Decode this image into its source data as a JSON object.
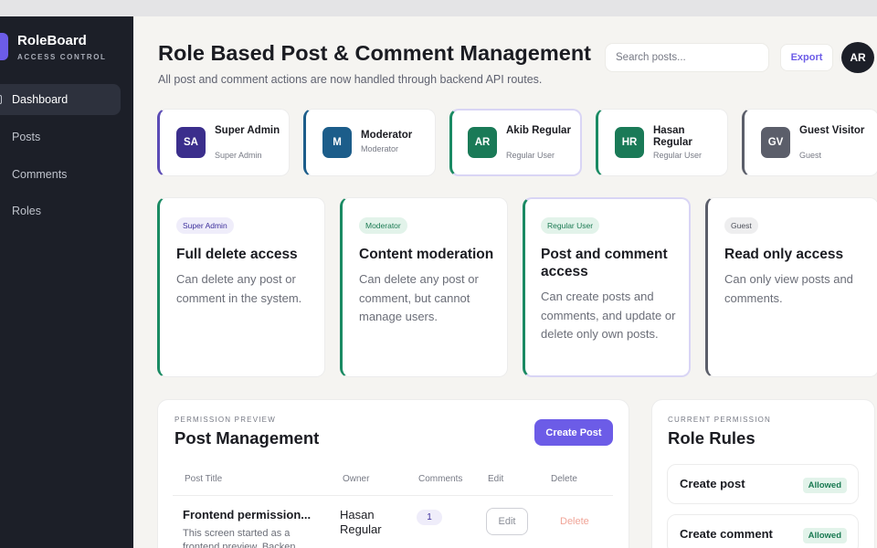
{
  "brand": {
    "name": "RoleBoard",
    "subtitle": "ACCESS CONTROL"
  },
  "sidebar": {
    "items": [
      {
        "label": "Dashboard",
        "active": true
      },
      {
        "label": "Posts"
      },
      {
        "label": "Comments"
      },
      {
        "label": "Roles"
      }
    ]
  },
  "header": {
    "title": "Role Based Post & Comment Management",
    "subtitle": "All post and comment actions are now handled through backend API routes.",
    "search_placeholder": "Search posts...",
    "export_label": "Export",
    "avatar_initials": "AR"
  },
  "users": [
    {
      "initials": "SA",
      "name": "Super Admin",
      "role": "Super Admin",
      "color": "#3b2e8c"
    },
    {
      "initials": "M",
      "name": "Moderator",
      "role": "Moderator",
      "color": "#1c5d8a"
    },
    {
      "initials": "AR",
      "name": "Akib Regular",
      "role": "Regular User",
      "color": "#1a7a57"
    },
    {
      "initials": "HR",
      "name": "Hasan Regular",
      "role": "Regular User",
      "color": "#1a7a57"
    },
    {
      "initials": "GV",
      "name": "Guest Visitor",
      "role": "Guest",
      "color": "#5b5e6a"
    }
  ],
  "permissions": [
    {
      "badge": "Super Admin",
      "title": "Full delete access",
      "desc": "Can delete any post or comment in the system."
    },
    {
      "badge": "Moderator",
      "title": "Content moderation",
      "desc": "Can delete any post or comment, but cannot manage users."
    },
    {
      "badge": "Regular User",
      "title": "Post and comment access",
      "desc": "Can create posts and comments, and update or delete only own posts."
    },
    {
      "badge": "Guest",
      "title": "Read only access",
      "desc": "Can only view posts and comments."
    }
  ],
  "post_management": {
    "eyebrow": "PERMISSION PREVIEW",
    "title": "Post Management",
    "create_label": "Create Post",
    "columns": [
      "Post Title",
      "Owner",
      "Comments",
      "Edit",
      "Delete"
    ],
    "rows": [
      {
        "title": "Frontend permission...",
        "excerpt": "This screen started as a frontend preview. Backen...",
        "owner": "Hasan Regular",
        "comments": "1",
        "edit_label": "Edit",
        "delete_label": "Delete"
      }
    ]
  },
  "role_rules": {
    "eyebrow": "CURRENT PERMISSION",
    "title": "Role Rules",
    "rules": [
      {
        "name": "Create post",
        "status": "Allowed"
      },
      {
        "name": "Create comment",
        "status": "Allowed"
      }
    ]
  },
  "colors": {
    "accent": "#6c5ce7",
    "sidebar_bg": "#1c1f28",
    "allowed_green": "#1a7a52"
  }
}
